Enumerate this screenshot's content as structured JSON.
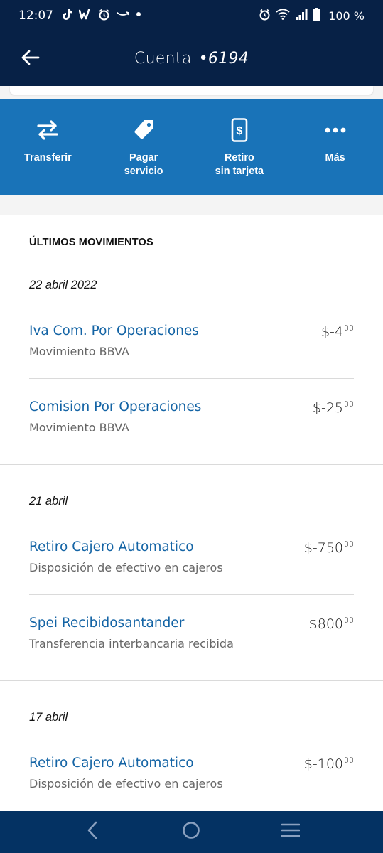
{
  "status_bar": {
    "time": "12:07",
    "battery": "100 %",
    "left_icons": [
      "tiktok-icon",
      "wattpad-icon",
      "alarm-icon",
      "amazon-icon",
      "dot-icon"
    ],
    "right_icons": [
      "alarm-icon",
      "wifi-icon",
      "signal-icon",
      "battery-icon"
    ]
  },
  "header": {
    "title": "Cuenta",
    "account": "•6194",
    "back_icon": "arrow-left-icon"
  },
  "actions": [
    {
      "label": "Transferir",
      "icon": "transfer-arrows-icon"
    },
    {
      "label": "Pagar\nservicio",
      "icon": "tag-icon"
    },
    {
      "label": "Retiro\nsin tarjeta",
      "icon": "phone-dollar-icon"
    },
    {
      "label": "Más",
      "icon": "more-dots-icon"
    }
  ],
  "movements": {
    "title": "ÚLTIMOS MOVIMIENTOS",
    "groups": [
      {
        "date": "22 abril 2022",
        "items": [
          {
            "name": "Iva Com. Por Operaciones",
            "description": "Movimiento BBVA",
            "amount": "$-4",
            "cents": "00"
          },
          {
            "name": "Comision Por Operaciones",
            "description": "Movimiento BBVA",
            "amount": "$-25",
            "cents": "00"
          }
        ]
      },
      {
        "date": "21 abril",
        "items": [
          {
            "name": "Retiro Cajero Automatico",
            "description": "Disposición de efectivo en cajeros",
            "amount": "$-750",
            "cents": "00"
          },
          {
            "name": "Spei Recibidosantander",
            "description": "Transferencia interbancaria recibida",
            "amount": "$800",
            "cents": "00"
          }
        ]
      },
      {
        "date": "17 abril",
        "items": [
          {
            "name": "Retiro Cajero Automatico",
            "description": "Disposición de efectivo en cajeros",
            "amount": "$-100",
            "cents": "00"
          }
        ]
      }
    ]
  },
  "navigation": [
    "back-nav-icon",
    "home-nav-icon",
    "recents-nav-icon"
  ],
  "colors": {
    "header_navy": "#072146",
    "actions_blue": "#1973b8",
    "link_blue": "#1464a5",
    "nav_bar": "#043263"
  }
}
